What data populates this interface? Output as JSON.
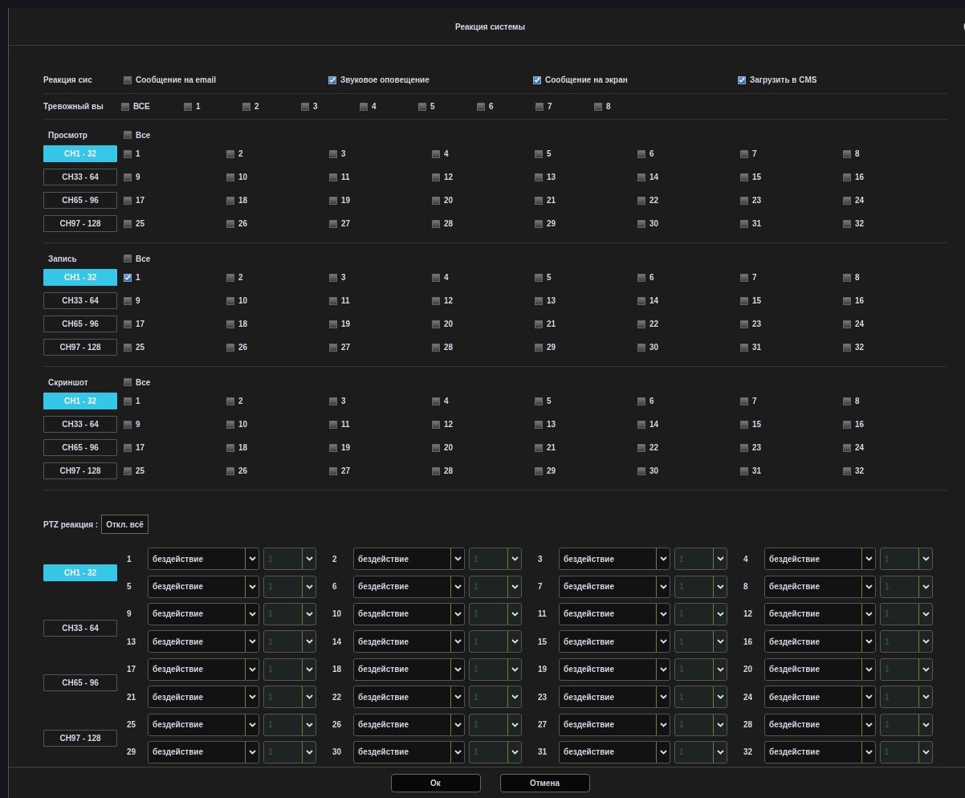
{
  "window": {
    "title": "Реакция системы"
  },
  "system_reaction": {
    "label": "Реакция сис",
    "options": [
      {
        "label": "Сообщение на email",
        "checked": false
      },
      {
        "label": "Звуковое оповещение",
        "checked": true
      },
      {
        "label": "Сообщение на экран",
        "checked": true
      },
      {
        "label": "Загрузить в CMS",
        "checked": true
      }
    ]
  },
  "alarm_output": {
    "label": "Тревожный вы",
    "options": [
      {
        "label": "ВСЕ",
        "checked": false
      },
      {
        "label": "1",
        "checked": false
      },
      {
        "label": "2",
        "checked": false
      },
      {
        "label": "3",
        "checked": false
      },
      {
        "label": "4",
        "checked": false
      },
      {
        "label": "5",
        "checked": false
      },
      {
        "label": "6",
        "checked": false
      },
      {
        "label": "7",
        "checked": false
      },
      {
        "label": "8",
        "checked": false
      }
    ]
  },
  "sections": [
    {
      "label": "Просмотр",
      "all": {
        "label": "Все",
        "checked": false
      },
      "ranges": [
        {
          "label": "CH1 - 32",
          "selected": true
        },
        {
          "label": "CH33 - 64",
          "selected": false
        },
        {
          "label": "CH65 - 96",
          "selected": false
        },
        {
          "label": "CH97 - 128",
          "selected": false
        }
      ],
      "channels": [
        {
          "label": "1",
          "checked": false
        },
        {
          "label": "2",
          "checked": false
        },
        {
          "label": "3",
          "checked": false
        },
        {
          "label": "4",
          "checked": false
        },
        {
          "label": "5",
          "checked": false
        },
        {
          "label": "6",
          "checked": false
        },
        {
          "label": "7",
          "checked": false
        },
        {
          "label": "8",
          "checked": false
        },
        {
          "label": "9",
          "checked": false
        },
        {
          "label": "10",
          "checked": false
        },
        {
          "label": "11",
          "checked": false
        },
        {
          "label": "12",
          "checked": false
        },
        {
          "label": "13",
          "checked": false
        },
        {
          "label": "14",
          "checked": false
        },
        {
          "label": "15",
          "checked": false
        },
        {
          "label": "16",
          "checked": false
        },
        {
          "label": "17",
          "checked": false
        },
        {
          "label": "18",
          "checked": false
        },
        {
          "label": "19",
          "checked": false
        },
        {
          "label": "20",
          "checked": false
        },
        {
          "label": "21",
          "checked": false
        },
        {
          "label": "22",
          "checked": false
        },
        {
          "label": "23",
          "checked": false
        },
        {
          "label": "24",
          "checked": false
        },
        {
          "label": "25",
          "checked": false
        },
        {
          "label": "26",
          "checked": false
        },
        {
          "label": "27",
          "checked": false
        },
        {
          "label": "28",
          "checked": false
        },
        {
          "label": "29",
          "checked": false
        },
        {
          "label": "30",
          "checked": false
        },
        {
          "label": "31",
          "checked": false
        },
        {
          "label": "32",
          "checked": false
        }
      ]
    },
    {
      "label": "Запись",
      "all": {
        "label": "Все",
        "checked": false
      },
      "ranges": [
        {
          "label": "CH1 - 32",
          "selected": true
        },
        {
          "label": "CH33 - 64",
          "selected": false
        },
        {
          "label": "CH65 - 96",
          "selected": false
        },
        {
          "label": "CH97 - 128",
          "selected": false
        }
      ],
      "channels": [
        {
          "label": "1",
          "checked": true
        },
        {
          "label": "2",
          "checked": false
        },
        {
          "label": "3",
          "checked": false
        },
        {
          "label": "4",
          "checked": false
        },
        {
          "label": "5",
          "checked": false
        },
        {
          "label": "6",
          "checked": false
        },
        {
          "label": "7",
          "checked": false
        },
        {
          "label": "8",
          "checked": false
        },
        {
          "label": "9",
          "checked": false
        },
        {
          "label": "10",
          "checked": false
        },
        {
          "label": "11",
          "checked": false
        },
        {
          "label": "12",
          "checked": false
        },
        {
          "label": "13",
          "checked": false
        },
        {
          "label": "14",
          "checked": false
        },
        {
          "label": "15",
          "checked": false
        },
        {
          "label": "16",
          "checked": false
        },
        {
          "label": "17",
          "checked": false
        },
        {
          "label": "18",
          "checked": false
        },
        {
          "label": "19",
          "checked": false
        },
        {
          "label": "20",
          "checked": false
        },
        {
          "label": "21",
          "checked": false
        },
        {
          "label": "22",
          "checked": false
        },
        {
          "label": "23",
          "checked": false
        },
        {
          "label": "24",
          "checked": false
        },
        {
          "label": "25",
          "checked": false
        },
        {
          "label": "26",
          "checked": false
        },
        {
          "label": "27",
          "checked": false
        },
        {
          "label": "28",
          "checked": false
        },
        {
          "label": "29",
          "checked": false
        },
        {
          "label": "30",
          "checked": false
        },
        {
          "label": "31",
          "checked": false
        },
        {
          "label": "32",
          "checked": false
        }
      ]
    },
    {
      "label": "Скриншот",
      "all": {
        "label": "Все",
        "checked": false
      },
      "ranges": [
        {
          "label": "CH1 - 32",
          "selected": true
        },
        {
          "label": "CH33 - 64",
          "selected": false
        },
        {
          "label": "CH65 - 96",
          "selected": false
        },
        {
          "label": "CH97 - 128",
          "selected": false
        }
      ],
      "channels": [
        {
          "label": "1",
          "checked": false
        },
        {
          "label": "2",
          "checked": false
        },
        {
          "label": "3",
          "checked": false
        },
        {
          "label": "4",
          "checked": false
        },
        {
          "label": "5",
          "checked": false
        },
        {
          "label": "6",
          "checked": false
        },
        {
          "label": "7",
          "checked": false
        },
        {
          "label": "8",
          "checked": false
        },
        {
          "label": "9",
          "checked": false
        },
        {
          "label": "10",
          "checked": false
        },
        {
          "label": "11",
          "checked": false
        },
        {
          "label": "12",
          "checked": false
        },
        {
          "label": "13",
          "checked": false
        },
        {
          "label": "14",
          "checked": false
        },
        {
          "label": "15",
          "checked": false
        },
        {
          "label": "16",
          "checked": false
        },
        {
          "label": "17",
          "checked": false
        },
        {
          "label": "18",
          "checked": false
        },
        {
          "label": "19",
          "checked": false
        },
        {
          "label": "20",
          "checked": false
        },
        {
          "label": "21",
          "checked": false
        },
        {
          "label": "22",
          "checked": false
        },
        {
          "label": "23",
          "checked": false
        },
        {
          "label": "24",
          "checked": false
        },
        {
          "label": "25",
          "checked": false
        },
        {
          "label": "26",
          "checked": false
        },
        {
          "label": "27",
          "checked": false
        },
        {
          "label": "28",
          "checked": false
        },
        {
          "label": "29",
          "checked": false
        },
        {
          "label": "30",
          "checked": false
        },
        {
          "label": "31",
          "checked": false
        },
        {
          "label": "32",
          "checked": false
        }
      ]
    }
  ],
  "ptz": {
    "label": "PTZ реакция :",
    "disable_all_button": "Откл. всё",
    "ranges": [
      {
        "label": "CH1 - 32",
        "selected": true
      },
      {
        "label": "CH33 - 64",
        "selected": false
      },
      {
        "label": "CH65 - 96",
        "selected": false
      },
      {
        "label": "CH97 - 128",
        "selected": false
      }
    ],
    "channels": [
      {
        "number": "1",
        "action": "бездействие",
        "preset": "1",
        "disabled": true
      },
      {
        "number": "2",
        "action": "бездействие",
        "preset": "1",
        "disabled": true
      },
      {
        "number": "3",
        "action": "бездействие",
        "preset": "1",
        "disabled": true
      },
      {
        "number": "4",
        "action": "бездействие",
        "preset": "1",
        "disabled": true
      },
      {
        "number": "5",
        "action": "бездействие",
        "preset": "1",
        "disabled": true
      },
      {
        "number": "6",
        "action": "бездействие",
        "preset": "1",
        "disabled": true
      },
      {
        "number": "7",
        "action": "бездействие",
        "preset": "1",
        "disabled": true
      },
      {
        "number": "8",
        "action": "бездействие",
        "preset": "1",
        "disabled": true
      },
      {
        "number": "9",
        "action": "бездействие",
        "preset": "1",
        "disabled": true
      },
      {
        "number": "10",
        "action": "бездействие",
        "preset": "1",
        "disabled": true
      },
      {
        "number": "11",
        "action": "бездействие",
        "preset": "1",
        "disabled": true
      },
      {
        "number": "12",
        "action": "бездействие",
        "preset": "1",
        "disabled": true
      },
      {
        "number": "13",
        "action": "бездействие",
        "preset": "1",
        "disabled": true
      },
      {
        "number": "14",
        "action": "бездействие",
        "preset": "1",
        "disabled": true
      },
      {
        "number": "15",
        "action": "бездействие",
        "preset": "1",
        "disabled": true
      },
      {
        "number": "16",
        "action": "бездействие",
        "preset": "1",
        "disabled": true
      },
      {
        "number": "17",
        "action": "бездействие",
        "preset": "1",
        "disabled": true
      },
      {
        "number": "18",
        "action": "бездействие",
        "preset": "1",
        "disabled": true
      },
      {
        "number": "19",
        "action": "бездействие",
        "preset": "1",
        "disabled": true
      },
      {
        "number": "20",
        "action": "бездействие",
        "preset": "1",
        "disabled": true
      },
      {
        "number": "21",
        "action": "бездействие",
        "preset": "1",
        "disabled": true
      },
      {
        "number": "22",
        "action": "бездействие",
        "preset": "1",
        "disabled": true
      },
      {
        "number": "23",
        "action": "бездействие",
        "preset": "1",
        "disabled": true
      },
      {
        "number": "24",
        "action": "бездействие",
        "preset": "1",
        "disabled": true
      },
      {
        "number": "25",
        "action": "бездействие",
        "preset": "1",
        "disabled": true
      },
      {
        "number": "26",
        "action": "бездействие",
        "preset": "1",
        "disabled": true
      },
      {
        "number": "27",
        "action": "бездействие",
        "preset": "1",
        "disabled": true
      },
      {
        "number": "28",
        "action": "бездействие",
        "preset": "1",
        "disabled": true
      },
      {
        "number": "29",
        "action": "бездействие",
        "preset": "1",
        "disabled": true
      },
      {
        "number": "30",
        "action": "бездействие",
        "preset": "1",
        "disabled": true
      },
      {
        "number": "31",
        "action": "бездействие",
        "preset": "1",
        "disabled": true
      },
      {
        "number": "32",
        "action": "бездействие",
        "preset": "1",
        "disabled": true
      }
    ]
  },
  "buttons": [
    "Ок",
    "Отмена"
  ]
}
